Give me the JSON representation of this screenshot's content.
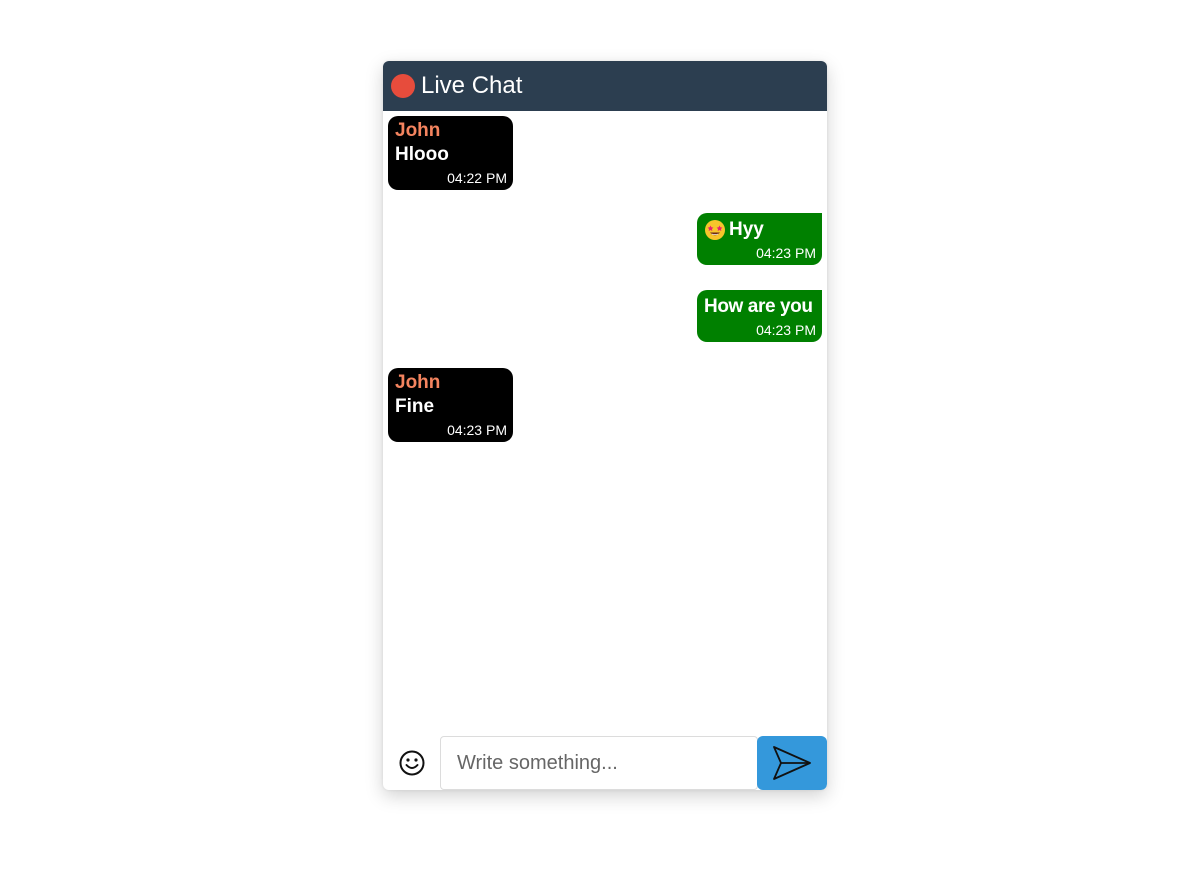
{
  "window": {
    "title": "Live Chat",
    "status_color": "#e74c3c",
    "header_color": "#2c3e50"
  },
  "messages": [
    {
      "direction": "received",
      "sender": "John",
      "text": "Hlooo",
      "time": "04:22 PM"
    },
    {
      "direction": "sent",
      "emoji": "star-struck-emoji",
      "text": "Hyy",
      "time": "04:23 PM"
    },
    {
      "direction": "sent",
      "text": "How are you",
      "time": "04:23 PM"
    },
    {
      "direction": "received",
      "sender": "John",
      "text": "Fine",
      "time": "04:23 PM"
    }
  ],
  "colors": {
    "sender_name": "#f4845f",
    "received_bubble": "#000000",
    "sent_bubble": "#008000",
    "send_button": "#3498db"
  },
  "input": {
    "placeholder": "Write something...",
    "value": ""
  },
  "icons": {
    "emoji_button": "smiley-face-icon",
    "send_button": "paper-plane-icon"
  }
}
